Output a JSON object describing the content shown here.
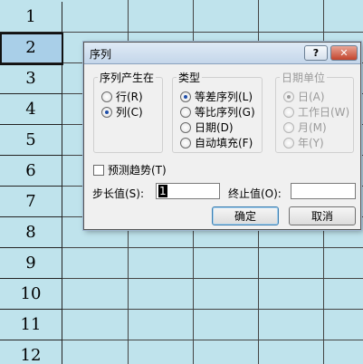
{
  "sheet": {
    "row_numbers": [
      "1",
      "2",
      "3",
      "4",
      "5",
      "6",
      "7",
      "8",
      "9",
      "10",
      "11",
      "12"
    ],
    "selected_row": "2"
  },
  "dialog": {
    "title": "序列",
    "help_label": "?",
    "close_label": "✕",
    "series_in": {
      "title": "序列产生在",
      "options": [
        {
          "label": "行(R)",
          "checked": false
        },
        {
          "label": "列(C)",
          "checked": true
        }
      ]
    },
    "type": {
      "title": "类型",
      "options": [
        {
          "label": "等差序列(L)",
          "checked": true
        },
        {
          "label": "等比序列(G)",
          "checked": false
        },
        {
          "label": "日期(D)",
          "checked": false
        },
        {
          "label": "自动填充(F)",
          "checked": false
        }
      ]
    },
    "date_unit": {
      "title": "日期单位",
      "options": [
        {
          "label": "日(A)",
          "checked": true
        },
        {
          "label": "工作日(W)",
          "checked": false
        },
        {
          "label": "月(M)",
          "checked": false
        },
        {
          "label": "年(Y)",
          "checked": false
        }
      ]
    },
    "trend_label": "预测趋势(T)",
    "step": {
      "label": "步长值(S):",
      "value": "1"
    },
    "stop": {
      "label": "终止值(O):",
      "value": ""
    },
    "ok_label": "确定",
    "cancel_label": "取消"
  }
}
